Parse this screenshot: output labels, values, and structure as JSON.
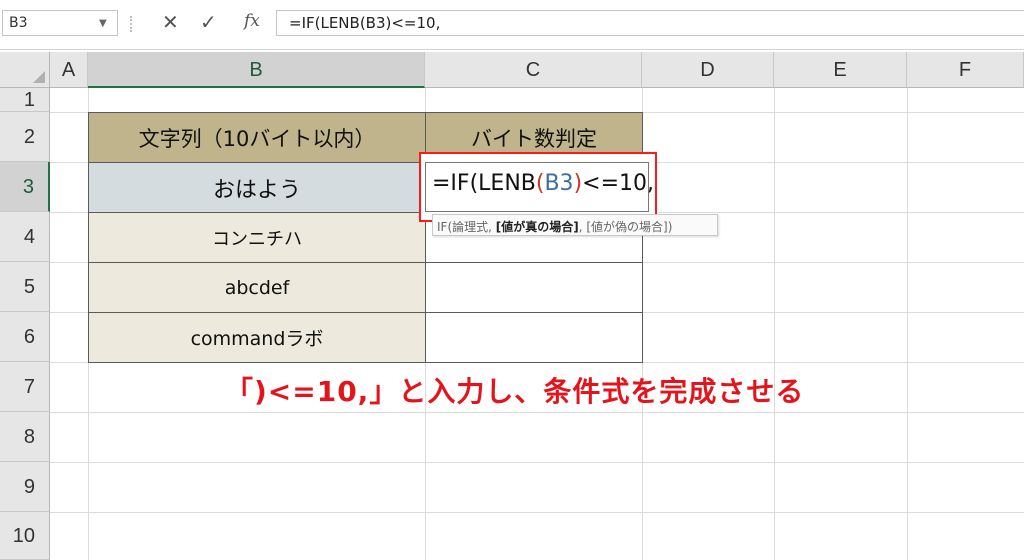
{
  "formula_bar": {
    "name_box": "B3",
    "cancel_icon": "✕",
    "enter_icon": "✓",
    "fx_label": "fx",
    "formula": "=IF(LENB(B3)<=10,"
  },
  "columns": [
    "A",
    "B",
    "C",
    "D",
    "E",
    "F"
  ],
  "rows": [
    "1",
    "2",
    "3",
    "4",
    "5",
    "6",
    "7",
    "8",
    "9",
    "10"
  ],
  "table": {
    "header_b": "文字列（10バイト以内）",
    "header_c": "バイト数判定",
    "b3": "おはよう",
    "b4": "コンニチハ",
    "b5": "abcdef",
    "b6": "commandラボ"
  },
  "editing": {
    "prefix": "=IF(LENB",
    "open_paren": "(",
    "ref": "B3",
    "close_paren": ")",
    "suffix": "<=10,"
  },
  "tooltip": {
    "start": "IF(論理式, ",
    "bold": "[値が真の場合]",
    "end": ", [値が偽の場合])"
  },
  "annotation": "「)<=10,」と入力し、条件式を完成させる",
  "colors": {
    "accent_green": "#217346",
    "header_fill": "#c0b48c",
    "data_fill": "#ede9dc",
    "selected_fill": "#d5dcdf",
    "highlight_red": "#e3141b"
  }
}
